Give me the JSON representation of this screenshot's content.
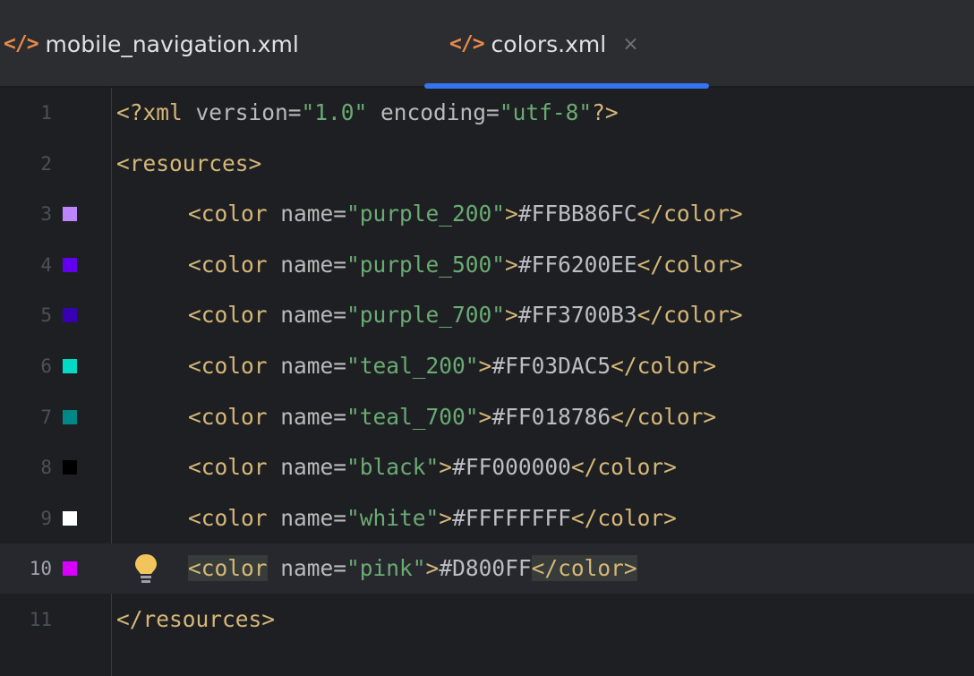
{
  "tabs": [
    {
      "icon": "</>",
      "label": "mobile_navigation.xml",
      "active": false
    },
    {
      "icon": "</>",
      "label": "colors.xml",
      "active": true,
      "close": "×"
    }
  ],
  "lines": [
    {
      "num": "1",
      "parts": [
        [
          "tag",
          "<?xml "
        ],
        [
          "attr",
          "version="
        ],
        [
          "str",
          "\"1.0\""
        ],
        [
          "attr",
          " encoding="
        ],
        [
          "str",
          "\"utf-8\""
        ],
        [
          "tag",
          "?>"
        ]
      ]
    },
    {
      "num": "2",
      "parts": [
        [
          "tag",
          "<resources>"
        ]
      ]
    },
    {
      "num": "3",
      "swatch": "#BB86FC",
      "parts": [
        [
          "tag",
          "<color "
        ],
        [
          "attr",
          "name="
        ],
        [
          "str",
          "\"purple_200\""
        ],
        [
          "tag",
          ">"
        ],
        [
          "txt",
          "#FFBB86FC"
        ],
        [
          "tag",
          "</color>"
        ]
      ]
    },
    {
      "num": "4",
      "swatch": "#6200EE",
      "parts": [
        [
          "tag",
          "<color "
        ],
        [
          "attr",
          "name="
        ],
        [
          "str",
          "\"purple_500\""
        ],
        [
          "tag",
          ">"
        ],
        [
          "txt",
          "#FF6200EE"
        ],
        [
          "tag",
          "</color>"
        ]
      ]
    },
    {
      "num": "5",
      "swatch": "#3700B3",
      "parts": [
        [
          "tag",
          "<color "
        ],
        [
          "attr",
          "name="
        ],
        [
          "str",
          "\"purple_700\""
        ],
        [
          "tag",
          ">"
        ],
        [
          "txt",
          "#FF3700B3"
        ],
        [
          "tag",
          "</color>"
        ]
      ]
    },
    {
      "num": "6",
      "swatch": "#03DAC5",
      "parts": [
        [
          "tag",
          "<color "
        ],
        [
          "attr",
          "name="
        ],
        [
          "str",
          "\"teal_200\""
        ],
        [
          "tag",
          ">"
        ],
        [
          "txt",
          "#FF03DAC5"
        ],
        [
          "tag",
          "</color>"
        ]
      ]
    },
    {
      "num": "7",
      "swatch": "#018786",
      "parts": [
        [
          "tag",
          "<color "
        ],
        [
          "attr",
          "name="
        ],
        [
          "str",
          "\"teal_700\""
        ],
        [
          "tag",
          ">"
        ],
        [
          "txt",
          "#FF018786"
        ],
        [
          "tag",
          "</color>"
        ]
      ]
    },
    {
      "num": "8",
      "swatch": "#000000",
      "parts": [
        [
          "tag",
          "<color "
        ],
        [
          "attr",
          "name="
        ],
        [
          "str",
          "\"black\""
        ],
        [
          "tag",
          ">"
        ],
        [
          "txt",
          "#FF000000"
        ],
        [
          "tag",
          "</color>"
        ]
      ]
    },
    {
      "num": "9",
      "swatch": "#FFFFFF",
      "parts": [
        [
          "tag",
          "<color "
        ],
        [
          "attr",
          "name="
        ],
        [
          "str",
          "\"white\""
        ],
        [
          "tag",
          ">"
        ],
        [
          "txt",
          "#FFFFFFFF"
        ],
        [
          "tag",
          "</color>"
        ]
      ]
    },
    {
      "num": "10",
      "swatch": "#D800FF",
      "current": true,
      "bulb": true,
      "parts": [
        [
          "tag hl",
          "<color"
        ],
        [
          "attr",
          " name="
        ],
        [
          "str",
          "\"pink\""
        ],
        [
          "tag",
          ">"
        ],
        [
          "txt",
          "#D800FF"
        ],
        [
          "tag hl",
          "</color>"
        ]
      ]
    },
    {
      "num": "11",
      "parts": [
        [
          "tag",
          "</resources>"
        ]
      ]
    }
  ],
  "colors": {
    "tab_underline": "#3574f0",
    "xml_tag": "#d5b778",
    "string": "#6aab73",
    "bulb": "#f2c55c"
  }
}
